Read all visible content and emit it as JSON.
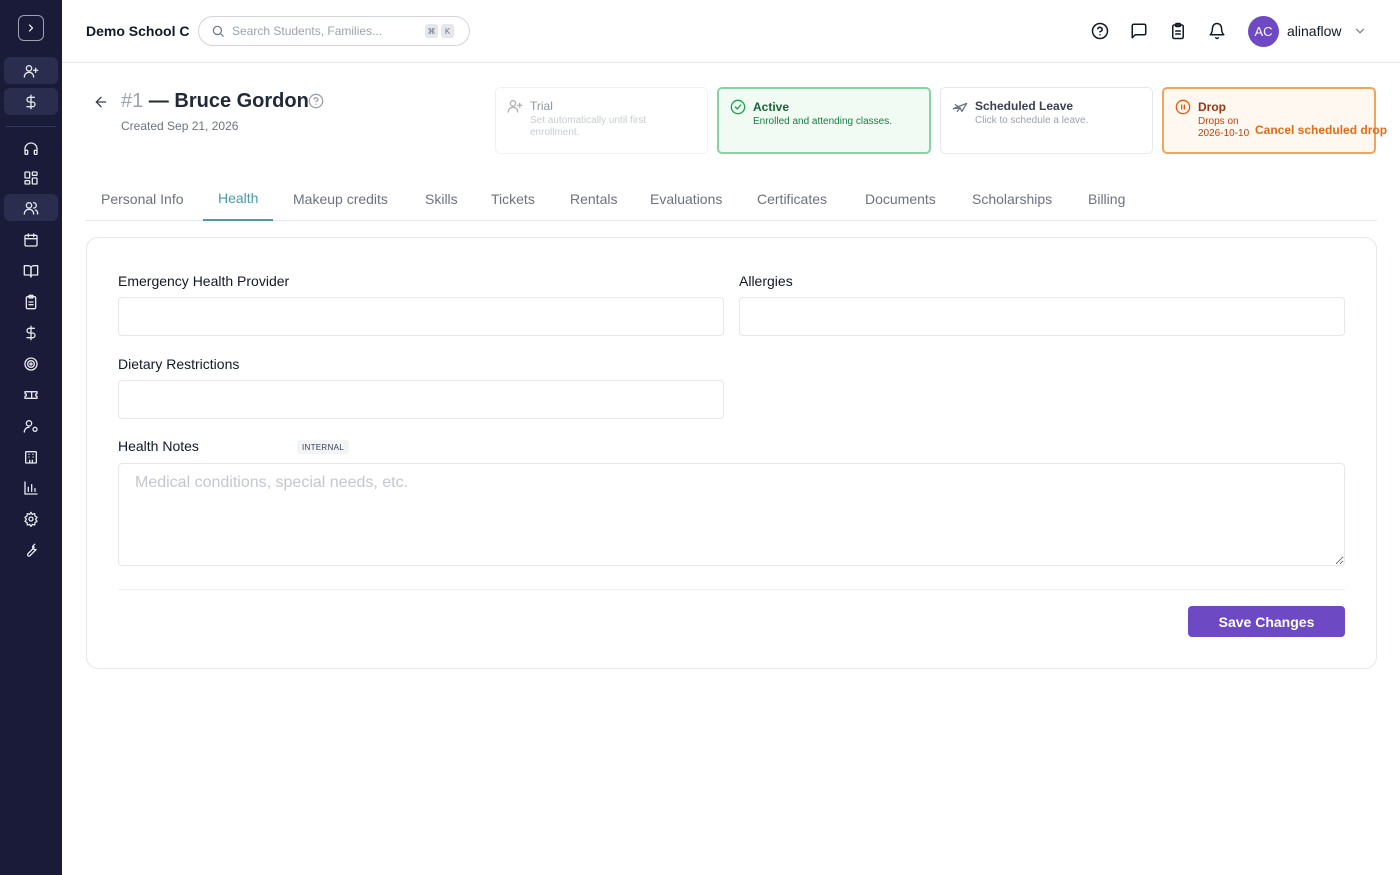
{
  "header": {
    "school_name": "Demo School C",
    "search_placeholder": "Search Students, Families...",
    "shortcut_keys": [
      "⌘",
      "K"
    ],
    "user_initials": "AC",
    "username": "alinaflow"
  },
  "student": {
    "number": "#1",
    "separator": " — ",
    "name": "Bruce Gordon",
    "created": "Created Sep 21, 2026"
  },
  "statuses": {
    "trial": {
      "title": "Trial",
      "description": "Set automatically until first enrollment."
    },
    "active": {
      "title": "Active",
      "description": "Enrolled and attending classes."
    },
    "leave": {
      "title": "Scheduled Leave",
      "description": "Click to schedule a leave."
    },
    "drop": {
      "title": "Drop",
      "description": "Drops on 2026-10-10",
      "action": "Cancel scheduled drop"
    }
  },
  "tabs": [
    "Personal Info",
    "Health",
    "Makeup credits",
    "Skills",
    "Tickets",
    "Rentals",
    "Evaluations",
    "Certificates",
    "Documents",
    "Scholarships",
    "Billing"
  ],
  "active_tab": "Health",
  "form": {
    "emergency_label": "Emergency Health Provider",
    "emergency_value": "",
    "allergies_label": "Allergies",
    "allergies_value": "",
    "dietary_label": "Dietary Restrictions",
    "dietary_value": "",
    "notes_label": "Health Notes",
    "notes_badge": "INTERNAL",
    "notes_placeholder": "Medical conditions, special needs, etc.",
    "save_label": "Save Changes"
  },
  "colors": {
    "sidebar_bg": "#1a1b38",
    "accent_purple": "#6d4ac4",
    "tab_active": "#4a9aa8",
    "active_green": "#86d4a3",
    "drop_orange": "#f0a45c"
  },
  "sidebar_icons": [
    "user-plus-icon",
    "dollar-icon",
    "headset-icon",
    "dashboard-icon",
    "users-icon",
    "calendar-icon",
    "book-icon",
    "clipboard-icon",
    "dollar-icon",
    "target-icon",
    "ticket-icon",
    "user-gear-icon",
    "building-icon",
    "bar-chart-icon",
    "settings-icon",
    "wrench-icon"
  ]
}
